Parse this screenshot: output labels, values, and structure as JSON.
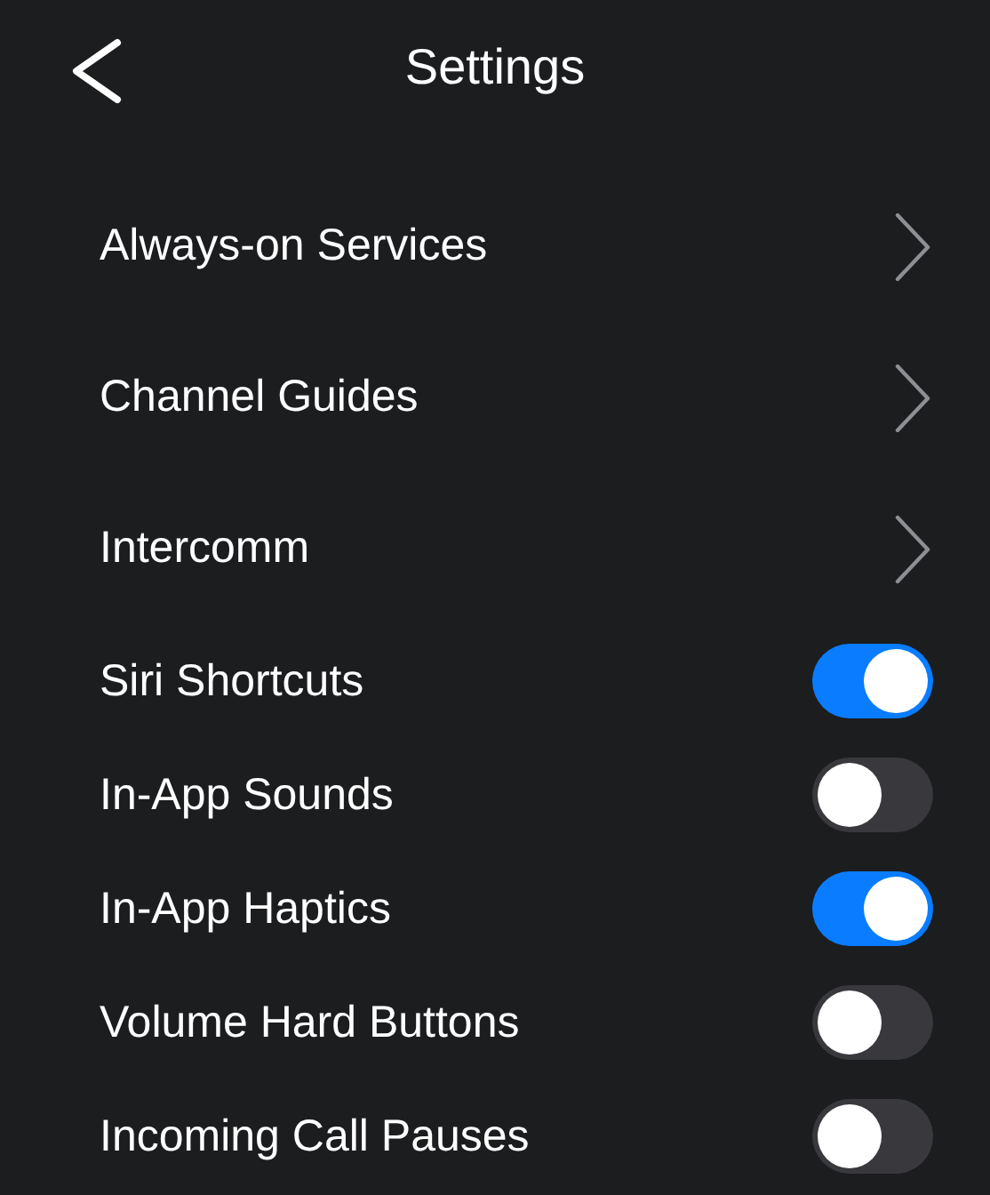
{
  "header": {
    "title": "Settings"
  },
  "items": [
    {
      "kind": "link",
      "label": "Always-on Services"
    },
    {
      "kind": "link",
      "label": "Channel Guides"
    },
    {
      "kind": "link",
      "label": "Intercomm"
    },
    {
      "kind": "toggle",
      "label": "Siri Shortcuts",
      "on": true
    },
    {
      "kind": "toggle",
      "label": "In-App Sounds",
      "on": false
    },
    {
      "kind": "toggle",
      "label": "In-App Haptics",
      "on": true
    },
    {
      "kind": "toggle",
      "label": "Volume Hard Buttons",
      "on": false
    },
    {
      "kind": "toggle",
      "label": "Incoming Call Pauses",
      "on": false
    }
  ]
}
